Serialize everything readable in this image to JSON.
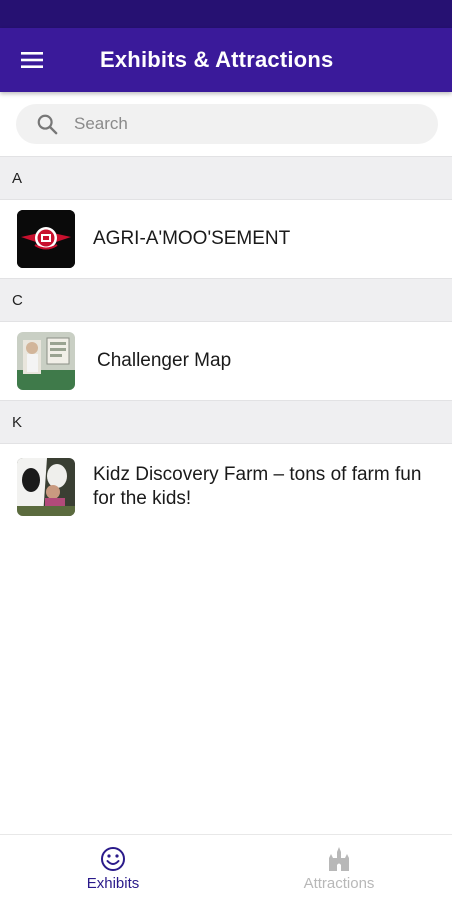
{
  "header": {
    "title": "Exhibits & Attractions"
  },
  "search": {
    "placeholder": "Search"
  },
  "sections": [
    {
      "letter": "A",
      "items": [
        {
          "label": "AGRI-A'MOO'SEMENT",
          "thumb": "agri-amoosement-logo"
        }
      ]
    },
    {
      "letter": "C",
      "items": [
        {
          "label": "Challenger Map",
          "thumb": "challenger-map-photo"
        }
      ]
    },
    {
      "letter": "K",
      "items": [
        {
          "label": "Kidz Discovery Farm – tons of farm fun for the kids!",
          "thumb": "kidz-discovery-farm-photo"
        }
      ]
    }
  ],
  "bottom_nav": {
    "items": [
      {
        "label": "Exhibits",
        "icon": "smiley-icon",
        "active": true
      },
      {
        "label": "Attractions",
        "icon": "castle-icon",
        "active": false
      }
    ]
  },
  "colors": {
    "status_bar": "#261172",
    "app_bar": "#3a1a9a",
    "active_nav": "#2a1a8a",
    "inactive_nav": "#b8b8b8"
  }
}
